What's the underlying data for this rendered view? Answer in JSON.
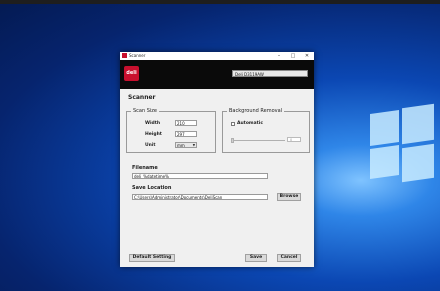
{
  "window": {
    "title": "Scanner",
    "minimize": "–",
    "maximize": "□",
    "close": "✕"
  },
  "header": {
    "brand": "deli",
    "device": "Deli D3119AW"
  },
  "main": {
    "heading": "Scanner",
    "scan_size": {
      "title": "Scan Size",
      "width_label": "Width",
      "width_value": "210",
      "height_label": "Height",
      "height_value": "297",
      "unit_label": "Unit",
      "unit_value": "mm"
    },
    "background_removal": {
      "title": "Background Removal",
      "automatic_label": "Automatic",
      "automatic_checked": false,
      "level_value": "0"
    },
    "filename": {
      "label": "Filename",
      "value": "deli_%datetime%"
    },
    "save_location": {
      "label": "Save Location",
      "value": "C:\\Users\\Administrator\\Documents\\DeliScan",
      "browse_label": "Browse"
    }
  },
  "footer": {
    "default_label": "Default Setting",
    "save_label": "Save",
    "cancel_label": "Cancel"
  },
  "colors": {
    "brand": "#c8102e",
    "header_bg": "#0a0a0a",
    "dialog_bg": "#f0f0f0",
    "desktop": "#0b47b3"
  }
}
